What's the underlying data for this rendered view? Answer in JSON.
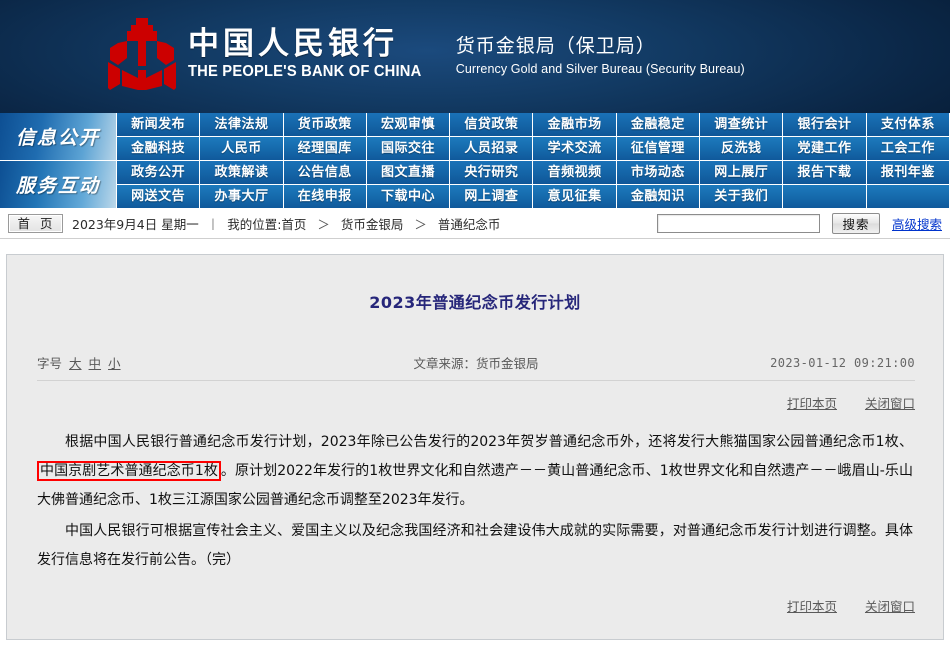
{
  "header": {
    "logo_icon": "pboc-emblem-icon",
    "bank_name_cn": "中国人民银行",
    "bank_name_en": "THE PEOPLE'S BANK OF CHINA",
    "bureau_cn": "货币金银局（保卫局）",
    "bureau_en": "Currency  Gold and Silver Bureau (Security Bureau)"
  },
  "nav": {
    "groups": [
      {
        "side_label": "信息公开",
        "rows": [
          [
            "新闻发布",
            "法律法规",
            "货币政策",
            "宏观审慎",
            "信贷政策",
            "金融市场",
            "金融稳定",
            "调查统计",
            "银行会计",
            "支付体系"
          ],
          [
            "金融科技",
            "人民币",
            "经理国库",
            "国际交往",
            "人员招录",
            "学术交流",
            "征信管理",
            "反洗钱",
            "党建工作",
            "工会工作"
          ]
        ]
      },
      {
        "side_label": "服务互动",
        "rows": [
          [
            "政务公开",
            "政策解读",
            "公告信息",
            "图文直播",
            "央行研究",
            "音频视频",
            "市场动态",
            "网上展厅",
            "报告下载",
            "报刊年鉴"
          ],
          [
            "网送文告",
            "办事大厅",
            "在线申报",
            "下载中心",
            "网上调查",
            "意见征集",
            "金融知识",
            "关于我们",
            "",
            ""
          ]
        ]
      }
    ]
  },
  "crumbbar": {
    "home_button": "首 页",
    "date": "2023年9月4日",
    "weekday": "星期一",
    "separator": "丨",
    "location_label": "我的位置:",
    "crumbs": [
      "首页",
      "货币金银局",
      "普通纪念币"
    ],
    "arrow": "＞",
    "search": {
      "value": "",
      "placeholder": "",
      "button_label": "搜索",
      "advanced_label": "高级搜索"
    }
  },
  "article": {
    "title": "2023年普通纪念币发行计划",
    "fontsize_label": "字号",
    "fontsize_options": [
      "大",
      "中",
      "小"
    ],
    "source": "文章来源：货币金银局",
    "time": "2023-01-12 09:21:00",
    "print_label": "打印本页",
    "close_label": "关闭窗口",
    "paragraph1_before": "根据中国人民银行普通纪念币发行计划，2023年除已公告发行的2023年贺岁普通纪念币外，还将发行大熊猫国家公园普通纪念币1枚、",
    "paragraph1_highlight": "中国京剧艺术普通纪念币1枚",
    "paragraph1_after": "。原计划2022年发行的1枚世界文化和自然遗产－－黄山普通纪念币、1枚世界文化和自然遗产－－峨眉山-乐山大佛普通纪念币、1枚三江源国家公园普通纪念币调整至2023年发行。",
    "paragraph2": "中国人民银行可根据宣传社会主义、爱国主义以及纪念我国经济和社会建设伟大成就的实际需要，对普通纪念币发行计划进行调整。具体发行信息将在发行前公告。（完）"
  },
  "colors": {
    "banner_dark": "#0b2747",
    "nav_blue": "#1464a6",
    "accent_red": "#cc0000",
    "highlight_red": "#ff0000",
    "title_navy": "#26267a",
    "link_blue": "#0033cc",
    "panel_bg": "#ebebeb"
  }
}
